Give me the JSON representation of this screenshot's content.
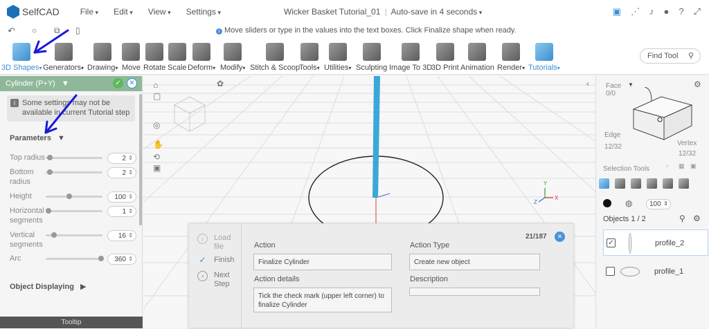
{
  "app": {
    "name": "SelfCAD"
  },
  "menus": [
    "File",
    "Edit",
    "View",
    "Settings"
  ],
  "header": {
    "doc_title": "Wicker Basket Tutorial_01",
    "autosave": "Auto-save in 4 seconds"
  },
  "top_icons": [
    "save-icon",
    "share-icon",
    "bell-icon",
    "user-icon",
    "help-icon",
    "fullscreen-icon"
  ],
  "tip_message": "Move sliders or type in the values into the text boxes. Click Finalize shape when ready.",
  "toolbar": {
    "tools": [
      "3D Shapes",
      "Generators",
      "Drawing",
      "Move",
      "Rotate",
      "Scale",
      "Deform",
      "Modify",
      "Stitch & Scoop",
      "Tools",
      "Utilities",
      "Sculpting",
      "Image To 3D",
      "3D Print",
      "Animation",
      "Render",
      "Tutorials"
    ],
    "find_tool_placeholder": "Find Tool"
  },
  "left_panel": {
    "shape_title": "Cylinder (P+Y)",
    "notice": "Some settings may not be available in current Tutorial step",
    "parameters_label": "Parameters",
    "params": [
      {
        "label": "Top radius",
        "value": "2",
        "fraction": 0.02
      },
      {
        "label": "Bottom radius",
        "value": "2",
        "fraction": 0.02
      },
      {
        "label": "Height",
        "value": "100",
        "fraction": 0.4
      },
      {
        "label": "Horizontal segments",
        "value": "1",
        "fraction": 0.0
      },
      {
        "label": "Vertical segments",
        "value": "16",
        "fraction": 0.1
      },
      {
        "label": "Arc",
        "value": "360",
        "fraction": 1.0
      }
    ],
    "object_displaying": "Object Displaying",
    "tooltip_label": "Tooltip"
  },
  "tutorial": {
    "counter": "21/187",
    "steps": [
      "Load file",
      "Finish",
      "Next Step"
    ],
    "action_label": "Action",
    "action_value": "Finalize Cylinder",
    "action_details_label": "Action details",
    "action_details_value": "Tick the check mark (upper left corner) to finalize Cylinder",
    "action_type_label": "Action Type",
    "action_type_value": "Create new object",
    "description_label": "Description",
    "description_value": ""
  },
  "right_panel": {
    "face_label": "Face",
    "face_count": "0/0",
    "edge_label": "Edge",
    "edge_count": "12/32",
    "vertex_label": "Vertex",
    "vertex_count": "12/32",
    "selection_tools_label": "Selection Tools",
    "brush_size": "100",
    "objects_label": "Objects 1 / 2",
    "objects": [
      {
        "name": "profile_2",
        "checked": true
      },
      {
        "name": "profile_1",
        "checked": false
      }
    ]
  },
  "colors": {
    "accent": "#3a8ed0",
    "panel_header": "#8fb89a",
    "annotation": "#1a1ad6"
  }
}
